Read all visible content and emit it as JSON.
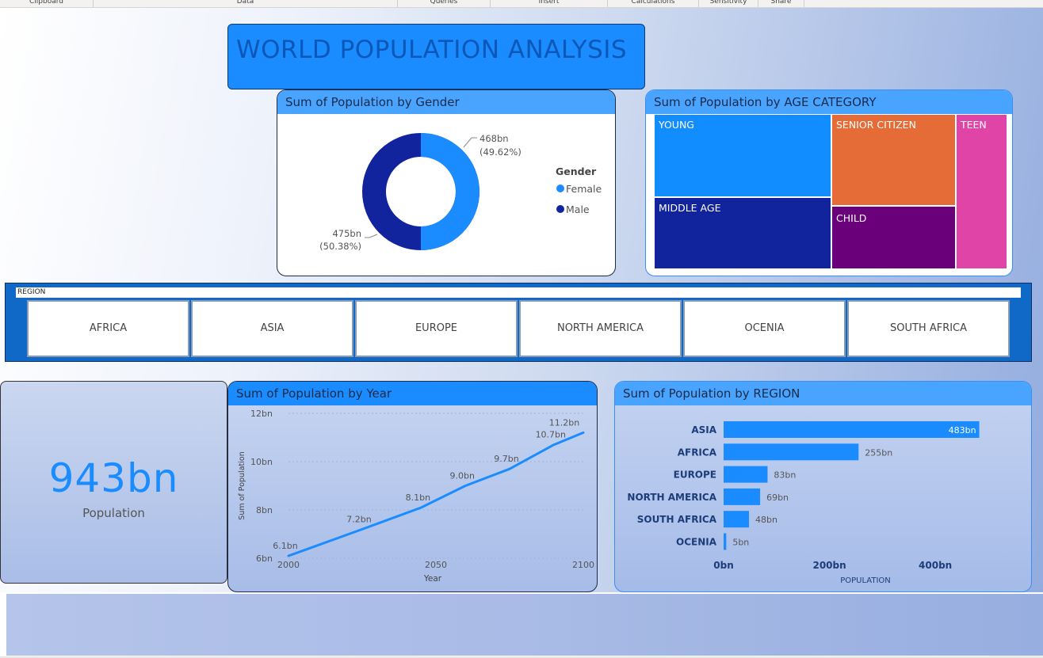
{
  "ribbon": [
    "Clipboard",
    "Data",
    "Queries",
    "Insert",
    "Calculations",
    "Sensitivity",
    "Share"
  ],
  "title": "WORLD POPULATION ANALYSIS",
  "gender_chart": {
    "title": "Sum of Population by Gender",
    "legend_title": "Gender",
    "female_label": "468bn",
    "female_pct": "(49.62%)",
    "male_label": "475bn",
    "male_pct": "(50.38%)",
    "legend": [
      "Female",
      "Male"
    ],
    "colors": {
      "female": "#1a8cff",
      "male": "#12239e"
    }
  },
  "age_chart": {
    "title": "Sum of Population by AGE CATEGORY",
    "tiles": [
      "YOUNG",
      "SENIOR CITIZEN",
      "TEEN",
      "MIDDLE AGE",
      "CHILD"
    ],
    "colors": {
      "young": "#118dff",
      "senior": "#e66c37",
      "teen": "#e044a7",
      "middle": "#12239e",
      "child": "#6b007b"
    }
  },
  "region_slicer": {
    "label": "REGION",
    "options": [
      "AFRICA",
      "ASIA",
      "EUROPE",
      "NORTH AMERICA",
      "OCENIA",
      "SOUTH AFRICA"
    ]
  },
  "kpi": {
    "value": "943bn",
    "label": "Population"
  },
  "chart_data": [
    {
      "type": "line",
      "title": "Sum of Population by Year",
      "xlabel": "Year",
      "ylabel": "Sum of Population",
      "x": [
        2000,
        2025,
        2045,
        2060,
        2075,
        2090,
        2100
      ],
      "y": [
        6.1,
        7.2,
        8.1,
        9.0,
        9.7,
        10.7,
        11.2
      ],
      "labels": [
        "6.1bn",
        "7.2bn",
        "8.1bn",
        "9.0bn",
        "9.7bn",
        "10.7bn",
        "11.2bn"
      ],
      "xticks": [
        "2000",
        "2050",
        "2100"
      ],
      "yticks": [
        "6bn",
        "8bn",
        "10bn",
        "12bn"
      ],
      "ylim": [
        6,
        12
      ],
      "xlim": [
        2000,
        2100
      ]
    },
    {
      "type": "bar",
      "title": "Sum of Population by REGION",
      "categories": [
        "ASIA",
        "AFRICA",
        "EUROPE",
        "NORTH AMERICA",
        "SOUTH AFRICA",
        "OCENIA"
      ],
      "values": [
        483,
        255,
        83,
        69,
        48,
        5
      ],
      "labels": [
        "483bn",
        "255bn",
        "83bn",
        "69bn",
        "48bn",
        "5bn"
      ],
      "xticks": [
        "0bn",
        "200bn",
        "400bn"
      ],
      "xlabel": "POPULATION",
      "xlim": [
        0,
        560
      ]
    }
  ]
}
